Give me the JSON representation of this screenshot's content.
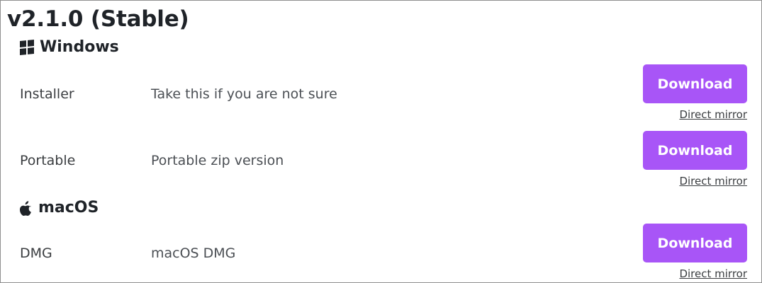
{
  "release": {
    "title": "v2.1.0 (Stable)"
  },
  "sections": {
    "windows": {
      "heading": "Windows",
      "icon": "windows-logo-icon",
      "rows": [
        {
          "name": "Installer",
          "description": "Take this if you are not sure",
          "download_label": "Download",
          "mirror_label": "Direct mirror"
        },
        {
          "name": "Portable",
          "description": "Portable zip version",
          "download_label": "Download",
          "mirror_label": "Direct mirror"
        }
      ]
    },
    "macos": {
      "heading": "macOS",
      "icon": "apple-logo-icon",
      "rows": [
        {
          "name": "DMG",
          "description": "macOS DMG",
          "download_label": "Download",
          "mirror_label": "Direct mirror"
        }
      ]
    }
  },
  "colors": {
    "accent": "#a855f7",
    "text": "#1f2328",
    "border": "#8f8f8f"
  }
}
